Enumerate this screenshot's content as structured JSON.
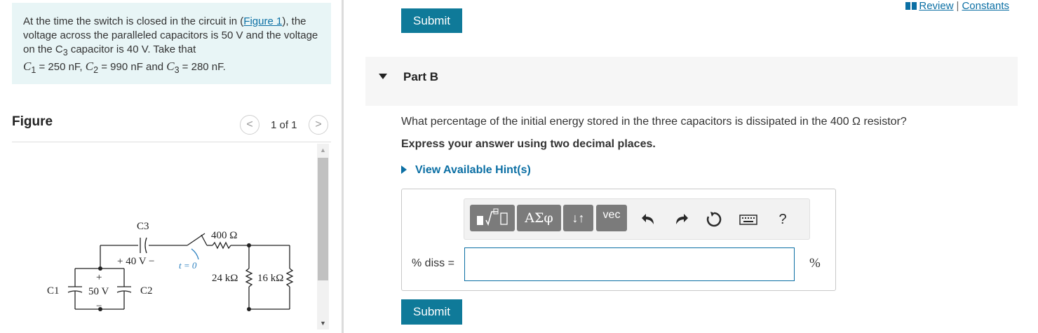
{
  "problem": {
    "text_1": "At the time the switch is closed in the circuit in (",
    "figure_link": "Figure 1",
    "text_2": "), the voltage across the paralleled capacitors is 50 V and the voltage on the C",
    "sub_3": "3",
    "text_3": " capacitor is 40 V. Take that",
    "c1": "C",
    "c1_sub": "1",
    "c1_val": " = 250 nF, ",
    "c2": "C",
    "c2_sub": "2",
    "c2_val": " = 990 nF and ",
    "c3": "C",
    "c3_sub": "3",
    "c3_val": " = 280 nF."
  },
  "figure_panel": {
    "title": "Figure",
    "prev": "<",
    "next": ">",
    "count": "1 of 1"
  },
  "circuit": {
    "c3_label": "C3",
    "c1_label": "C1",
    "c2_label": "C2",
    "v40": "+ 40 V −",
    "v50": "50 V",
    "plus": "+",
    "minus": "−",
    "switch_label": "t = 0",
    "r400": "400 Ω",
    "r24": "24 kΩ",
    "r16": "16 kΩ"
  },
  "header_links": {
    "review": "Review",
    "separator": "|",
    "constants": "Constants"
  },
  "submit_label": "Submit",
  "part": {
    "label": "Part B",
    "question": "What percentage of the initial energy stored in the three capacitors is dissipated in the 400 Ω resistor?",
    "instruction": "Express your answer using two decimal places.",
    "hint": "View Available Hint(s)"
  },
  "toolbar": {
    "greek": "ΑΣφ",
    "arrows": "↓↑",
    "vec": "vec",
    "help": "?"
  },
  "answer": {
    "label": "% diss =",
    "value": "",
    "unit": "%"
  },
  "colors": {
    "accent": "#0f7a99",
    "link": "#0b6fa4",
    "problem_bg": "#e8f5f6"
  }
}
